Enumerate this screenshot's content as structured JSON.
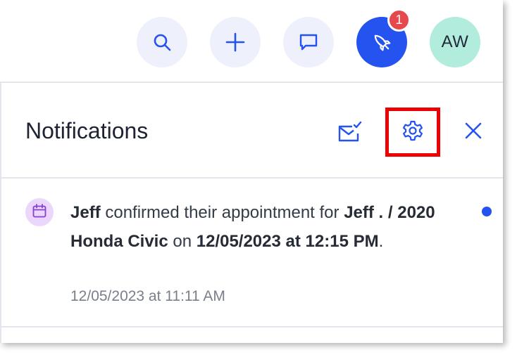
{
  "topbar": {
    "icons": [
      "search-icon",
      "plus-icon",
      "chat-icon",
      "rocket-icon"
    ],
    "notification_count": "1",
    "avatar_initials": "AW"
  },
  "panel": {
    "title": "Notifications",
    "header_icons": [
      "mark-read-icon",
      "gear-icon",
      "close-icon"
    ]
  },
  "notifications": [
    {
      "icon": "calendar-icon",
      "actor": "Jeff",
      "action_text": " confirmed their appointment for ",
      "subject": "Jeff . / 2020 Honda Civic",
      "on_text": " on ",
      "datetime": "12/05/2023 at 12:15 PM",
      "end_text": ".",
      "timestamp": "12/05/2023 at 11:11 AM",
      "unread": true
    }
  ],
  "colors": {
    "accent": "#2453ef",
    "badge": "#e5484d",
    "avatar_bg": "#b2ecdc",
    "highlight_box": "#ee0000",
    "calendar_icon_bg": "#ead7fb"
  }
}
